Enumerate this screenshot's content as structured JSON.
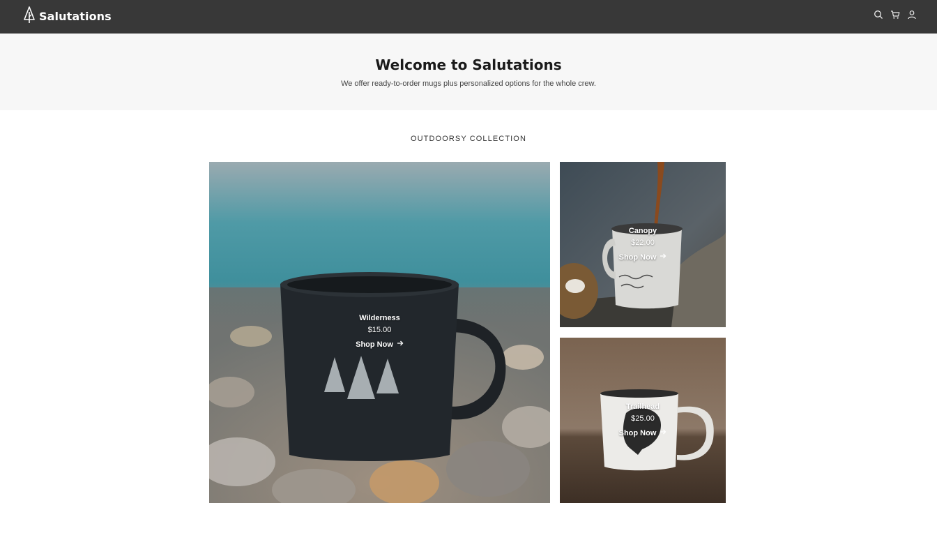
{
  "header": {
    "brand": "Salutations",
    "icons": [
      "tree-logo-icon",
      "search-icon",
      "cart-icon",
      "account-icon"
    ]
  },
  "hero": {
    "title": "Welcome to Salutations",
    "subtitle": "We offer ready-to-order mugs plus personalized options for the whole crew."
  },
  "collection": {
    "title": "OUTDOORSY COLLECTION",
    "products": [
      {
        "name": "Wilderness",
        "price": "$15.00",
        "cta": "Shop Now"
      },
      {
        "name": "Canopy",
        "price": "$22.00",
        "cta": "Shop Now"
      },
      {
        "name": "Trailhead",
        "price": "$25.00",
        "cta": "Shop Now"
      }
    ]
  },
  "colors": {
    "header_bg": "#383838",
    "hero_bg": "#f7f7f7",
    "text": "#1a1a1a"
  }
}
